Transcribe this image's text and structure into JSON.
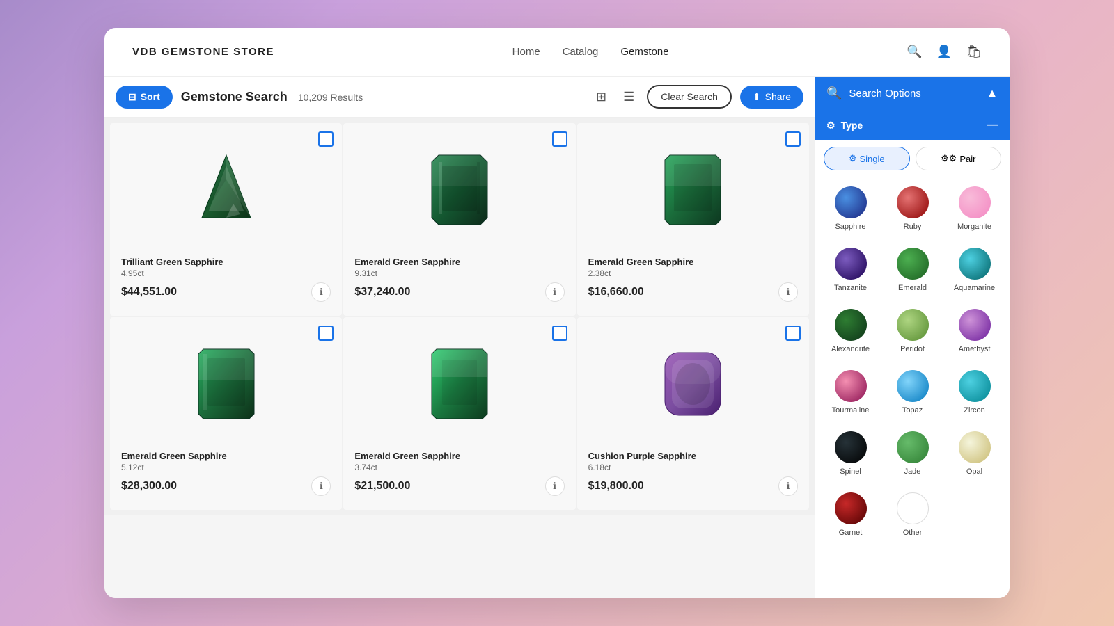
{
  "header": {
    "logo": "VDB GEMSTONE STORE",
    "nav": [
      {
        "label": "Home",
        "active": false
      },
      {
        "label": "Catalog",
        "active": false
      },
      {
        "label": "Gemstone",
        "active": true
      }
    ]
  },
  "toolbar": {
    "sort_label": "Sort",
    "search_title": "Gemstone Search",
    "result_count": "10,209 Results",
    "clear_search_label": "Clear Search",
    "share_label": "Share"
  },
  "products": [
    {
      "name": "Trilliant Green Sapphire",
      "weight": "4.95ct",
      "price": "$44,551.00",
      "color": "#1b6b3a",
      "shape": "trillion"
    },
    {
      "name": "Emerald Green Sapphire",
      "weight": "9.31ct",
      "price": "$37,240.00",
      "color": "#1a5c2e",
      "shape": "emerald"
    },
    {
      "name": "Emerald Green Sapphire",
      "weight": "2.38ct",
      "price": "$16,660.00",
      "color": "#1a7040",
      "shape": "emerald"
    },
    {
      "name": "Emerald Green Sapphire",
      "weight": "5.12ct",
      "price": "$28,300.00",
      "color": "#1b6b3a",
      "shape": "emerald"
    },
    {
      "name": "Emerald Green Sapphire",
      "weight": "3.74ct",
      "price": "$21,500.00",
      "color": "#1a5c2e",
      "shape": "emerald"
    },
    {
      "name": "Cushion Purple Sapphire",
      "weight": "6.18ct",
      "price": "$19,800.00",
      "color": "#7b4da0",
      "shape": "cushion"
    }
  ],
  "search_options": {
    "label": "Search Options"
  },
  "type_section": {
    "label": "Type",
    "single_label": "Single",
    "pair_label": "Pair",
    "gems": [
      {
        "name": "Sapphire",
        "color_class": "gem-sapphire"
      },
      {
        "name": "Ruby",
        "color_class": "gem-ruby"
      },
      {
        "name": "Morganite",
        "color_class": "gem-morganite"
      },
      {
        "name": "Tanzanite",
        "color_class": "gem-tanzanite"
      },
      {
        "name": "Emerald",
        "color_class": "gem-emerald"
      },
      {
        "name": "Aquamarine",
        "color_class": "gem-aquamarine"
      },
      {
        "name": "Alexandrite",
        "color_class": "gem-alexandrite"
      },
      {
        "name": "Peridot",
        "color_class": "gem-peridot"
      },
      {
        "name": "Amethyst",
        "color_class": "gem-amethyst"
      },
      {
        "name": "Tourmaline",
        "color_class": "gem-tourmaline"
      },
      {
        "name": "Topaz",
        "color_class": "gem-topaz"
      },
      {
        "name": "Zircon",
        "color_class": "gem-zircon"
      },
      {
        "name": "Spinel",
        "color_class": "gem-spinel"
      },
      {
        "name": "Jade",
        "color_class": "gem-jade"
      },
      {
        "name": "Opal",
        "color_class": "gem-opal"
      },
      {
        "name": "Garnet",
        "color_class": "gem-garnet"
      },
      {
        "name": "Other",
        "color_class": "gem-other"
      }
    ]
  }
}
